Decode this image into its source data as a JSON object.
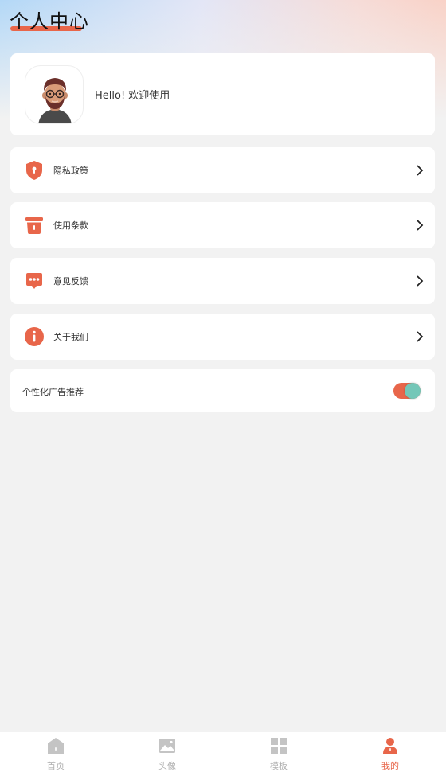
{
  "header": {
    "title": "个人中心"
  },
  "profile": {
    "greeting": "Hello! 欢迎使用"
  },
  "menu": [
    {
      "label": "隐私政策",
      "icon": "shield-icon"
    },
    {
      "label": "使用条款",
      "icon": "terms-icon"
    },
    {
      "label": "意见反馈",
      "icon": "feedback-icon"
    },
    {
      "label": "关于我们",
      "icon": "info-icon"
    }
  ],
  "settings": {
    "ad_toggle_label": "个性化广告推荐",
    "ad_toggle_on": true
  },
  "tabs": [
    {
      "label": "首页",
      "icon": "home-icon",
      "active": false
    },
    {
      "label": "头像",
      "icon": "image-icon",
      "active": false
    },
    {
      "label": "模板",
      "icon": "grid-icon",
      "active": false
    },
    {
      "label": "我的",
      "icon": "user-icon",
      "active": true
    }
  ],
  "colors": {
    "accent": "#e8664a",
    "toggle_knob": "#74c7b8",
    "inactive": "#b0b0b0"
  }
}
